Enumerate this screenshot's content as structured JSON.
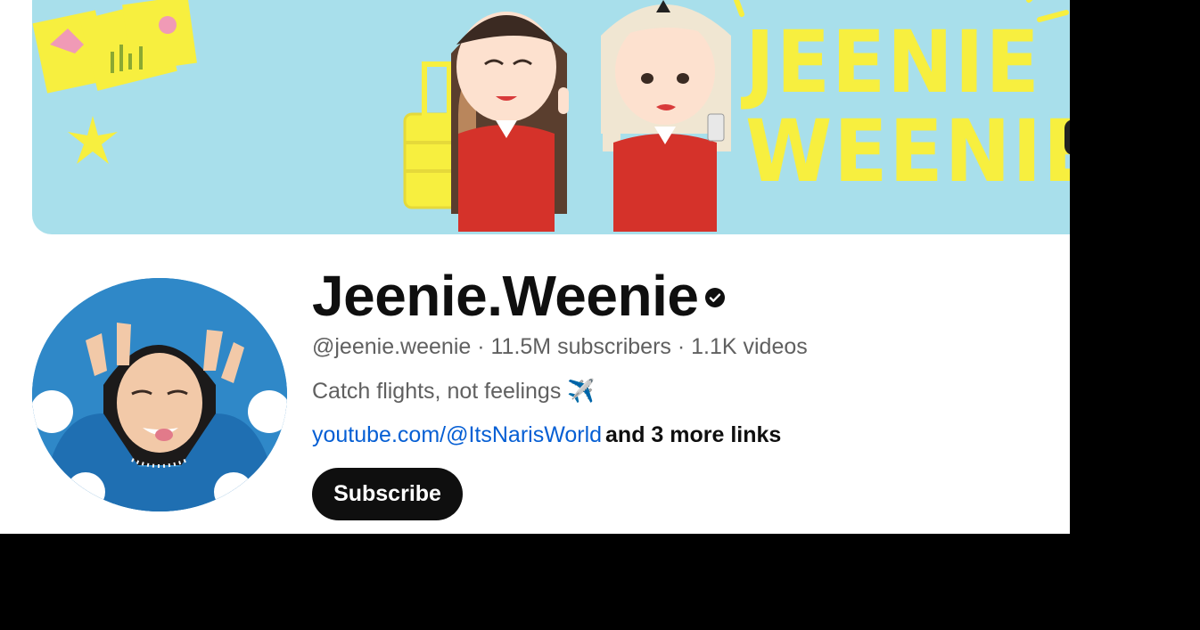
{
  "banner": {
    "title_line1": "JEENIE",
    "title_line2": "WEENIE"
  },
  "channel": {
    "name": "Jeenie.Weenie",
    "verified_icon": "verified-check-icon",
    "handle": "@jeenie.weenie",
    "subscribers": "11.5M subscribers",
    "videos": "1.1K videos",
    "separator": " · ",
    "description": "Catch flights, not feelings ✈️",
    "link": "youtube.com/@ItsNarisWorld",
    "more_links": "and 3 more links",
    "subscribe_label": "Subscribe"
  },
  "colors": {
    "banner_bg": "#a8dfeb",
    "banner_text": "#f7ef3f",
    "link": "#065fd4",
    "subscribe_bg": "#0f0f0f"
  }
}
